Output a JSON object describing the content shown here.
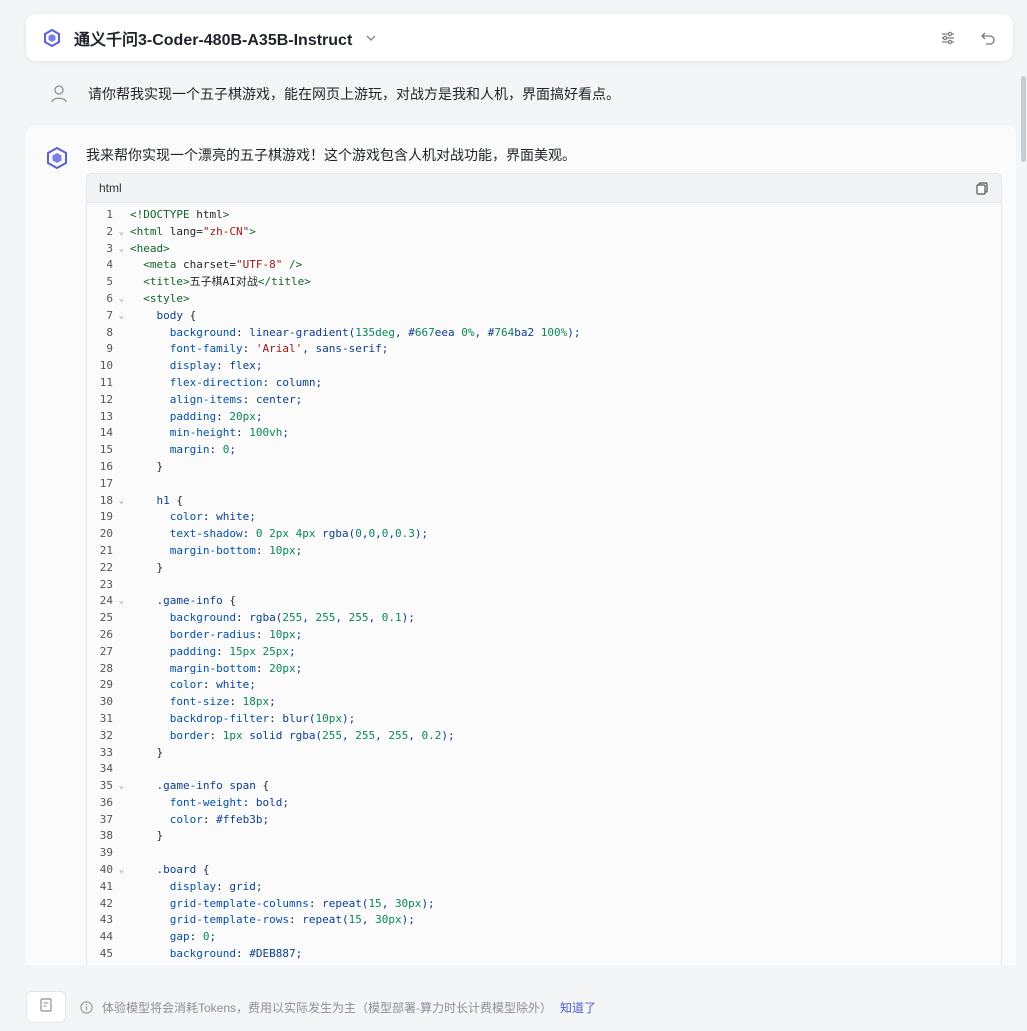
{
  "header": {
    "model_title": "通义千问3-Coder-480B-A35B-Instruct",
    "logo_icon": "qwen-logo-icon",
    "actions": [
      "settings-sliders-icon",
      "undo-icon"
    ],
    "accent_color": "#5b5fd9"
  },
  "conversation": {
    "user_message": "请你帮我实现一个五子棋游戏，能在网页上游玩，对战方是我和人机，界面搞好看点。",
    "assistant_message": "我来帮你实现一个漂亮的五子棋游戏！这个游戏包含人机对战功能，界面美观。"
  },
  "code_block": {
    "language": "html",
    "lines": [
      "<!DOCTYPE html>",
      "<html lang=\"zh-CN\">",
      "<head>",
      "  <meta charset=\"UTF-8\" />",
      "  <title>五子棋AI对战</title>",
      "  <style>",
      "    body {",
      "      background: linear-gradient(135deg, #667eea 0%, #764ba2 100%);",
      "      font-family: 'Arial', sans-serif;",
      "      display: flex;",
      "      flex-direction: column;",
      "      align-items: center;",
      "      padding: 20px;",
      "      min-height: 100vh;",
      "      margin: 0;",
      "    }",
      "",
      "    h1 {",
      "      color: white;",
      "      text-shadow: 0 2px 4px rgba(0,0,0,0.3);",
      "      margin-bottom: 10px;",
      "    }",
      "",
      "    .game-info {",
      "      background: rgba(255, 255, 255, 0.1);",
      "      border-radius: 10px;",
      "      padding: 15px 25px;",
      "      margin-bottom: 20px;",
      "      color: white;",
      "      font-size: 18px;",
      "      backdrop-filter: blur(10px);",
      "      border: 1px solid rgba(255, 255, 255, 0.2);",
      "    }",
      "",
      "    .game-info span {",
      "      font-weight: bold;",
      "      color: #ffeb3b;",
      "    }",
      "",
      "    .board {",
      "      display: grid;",
      "      grid-template-columns: repeat(15, 30px);",
      "      grid-template-rows: repeat(15, 30px);",
      "      gap: 0;",
      "      background: #DEB887;"
    ],
    "foldable_lines": [
      2,
      3,
      6,
      7,
      18,
      24,
      35,
      40
    ]
  },
  "footer": {
    "notice_text": "体验模型将会消耗Tokens，费用以实际发生为主（模型部署-算力时长计费模型除外）",
    "link_label": "知道了"
  }
}
